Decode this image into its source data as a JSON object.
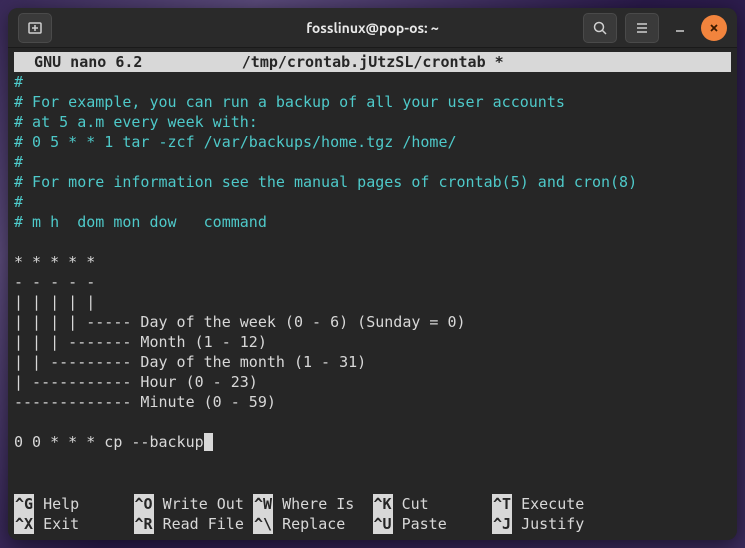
{
  "titlebar": {
    "title": "fosslinux@pop-os: ~"
  },
  "nano": {
    "header": "  GNU nano 6.2           /tmp/crontab.jUtzSL/crontab *                  ",
    "lines": {
      "l1": "#",
      "l2": "# For example, you can run a backup of all your user accounts",
      "l3": "# at 5 a.m every week with:",
      "l4": "# 0 5 * * 1 tar -zcf /var/backups/home.tgz /home/",
      "l5": "#",
      "l6": "# For more information see the manual pages of crontab(5) and cron(8)",
      "l7": "#",
      "l8": "# m h  dom mon dow   command",
      "p1": "* * * * *",
      "p2": "- - - - -",
      "p3": "| | | | |",
      "p4": "| | | | ----- Day of the week (0 - 6) (Sunday = 0)",
      "p5": "| | | ------- Month (1 - 12)",
      "p6": "| | --------- Day of the month (1 - 31)",
      "p7": "| ----------- Hour (0 - 23)",
      "p8": "------------- Minute (0 - 59)",
      "cmd": "0 0 * * * cp --backup"
    },
    "shortcuts": [
      {
        "key": "^G",
        "label": " Help"
      },
      {
        "key": "^O",
        "label": " Write Out"
      },
      {
        "key": "^W",
        "label": " Where Is"
      },
      {
        "key": "^K",
        "label": " Cut"
      },
      {
        "key": "^T",
        "label": " Execute"
      },
      {
        "key": "^X",
        "label": " Exit"
      },
      {
        "key": "^R",
        "label": " Read File"
      },
      {
        "key": "^\\",
        "label": " Replace"
      },
      {
        "key": "^U",
        "label": " Paste"
      },
      {
        "key": "^J",
        "label": " Justify"
      }
    ]
  }
}
